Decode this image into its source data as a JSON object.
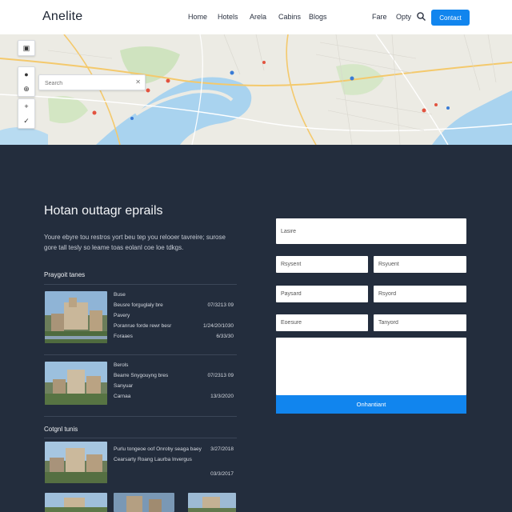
{
  "header": {
    "logo": "Anelite",
    "nav": [
      "Home",
      "Hotels",
      "Arela",
      "Cabins",
      "Blogs"
    ],
    "links_right": [
      "Fare",
      "Opty"
    ],
    "cta_label": "Contact"
  },
  "map": {
    "search_placeholder": "Search",
    "clear_icon": "x-icon",
    "zoom_in_label": "+",
    "zoom_out_label": "−",
    "controls": [
      "layers-icon",
      "pin-icon",
      "locate-icon",
      "compass-icon"
    ],
    "colors": {
      "land": "#ecebe4",
      "water": "#a9d3ef",
      "park": "#cfe3bf",
      "road": "#f4c96c"
    }
  },
  "content": {
    "heading": "Hotan outtagr eprails",
    "lead": "Youre ebyre tou restros yort beu tep you relooer tavreire; surose gore tall tesly so leame toas eolanl coe loe tdkgs.",
    "section1_title": "Praygoit tanes",
    "listings1": [
      {
        "title": "Buse",
        "lines": [
          "Beusre forguglaly bre",
          "Pavery",
          "Poranrue forde rewr besr",
          "Foraaes"
        ],
        "right": [
          "07/3213 09",
          "",
          "1/24/20/1030",
          "6/33/30"
        ]
      },
      {
        "title": "Berols",
        "lines": [
          "Bearre Snygouyng bres",
          "Sanyuar",
          "Carnaa"
        ],
        "right": [
          "07/2313 09",
          "",
          "13/3/2020"
        ]
      }
    ],
    "section2_title": "Cotgnl tunis",
    "listings2": [
      {
        "lines": [
          "Purlu tongeoe oof Onroby seaga baey",
          "Cearsarty Roang Laurba Invergus"
        ],
        "right": [
          "3/27/2018",
          "03/3/2017"
        ]
      }
    ]
  },
  "form": {
    "field_top": "Lasire",
    "row1": [
      "Rsysent",
      "Rsyuent"
    ],
    "row2": [
      "Paysard",
      "Rsyord"
    ],
    "row3": [
      "Eoesure",
      "Tanyord"
    ],
    "message_placeholder": "",
    "submit_label": "Onhantiant",
    "colors": {
      "accent": "#1185ee",
      "background": "#232d3d"
    }
  }
}
